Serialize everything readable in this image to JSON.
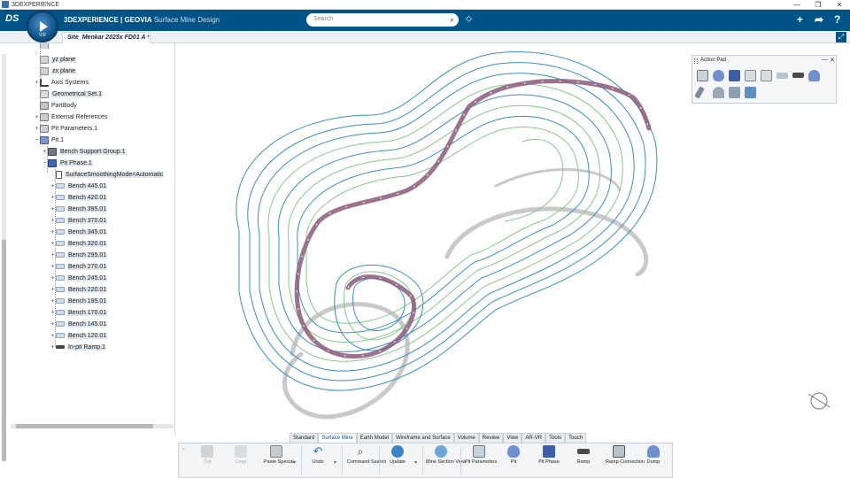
{
  "window": {
    "title": "3DEXPERIENCE",
    "controls": [
      "—",
      "❐",
      "✕"
    ]
  },
  "topbar": {
    "brand_bold": "3DEXPERIENCE | GEOVIA",
    "brand_app": "Surface Mine Design",
    "compass_label": "V.R",
    "search_placeholder": "Search"
  },
  "tabs": {
    "document": "Site_Menkar 2025x FD01 A",
    "add": "+"
  },
  "tree": {
    "items": [
      {
        "label": "yz plane",
        "level": 0
      },
      {
        "label": "zx plane",
        "level": 0
      },
      {
        "label": "Axis Systems",
        "level": 0
      },
      {
        "label": "Geometrical Set.1",
        "level": 0
      },
      {
        "label": "PartBody",
        "level": 0
      },
      {
        "label": "External References",
        "level": 0
      },
      {
        "label": "Pit Parameters.1",
        "level": 0
      },
      {
        "label": "Pit.1",
        "level": 0
      },
      {
        "label": "Bench Support Group.1",
        "level": 1
      },
      {
        "label": "Pit Phase.1",
        "level": 1
      },
      {
        "label": "SurfaceSmoothingMode=Automatic",
        "level": 2
      },
      {
        "label": "Bench 445.01",
        "level": 2
      },
      {
        "label": "Bench 420.01",
        "level": 2
      },
      {
        "label": "Bench 395.01",
        "level": 2
      },
      {
        "label": "Bench 370.01",
        "level": 2
      },
      {
        "label": "Bench 345.01",
        "level": 2
      },
      {
        "label": "Bench 320.01",
        "level": 2
      },
      {
        "label": "Bench 295.01",
        "level": 2
      },
      {
        "label": "Bench 270.01",
        "level": 2
      },
      {
        "label": "Bench 245.01",
        "level": 2
      },
      {
        "label": "Bench 220.01",
        "level": 2
      },
      {
        "label": "Bench 195.01",
        "level": 2
      },
      {
        "label": "Bench 170.01",
        "level": 2
      },
      {
        "label": "Bench 145.01",
        "level": 2
      },
      {
        "label": "Bench 120.01",
        "level": 2
      },
      {
        "label": "In-pit Ramp.1",
        "level": 2
      }
    ]
  },
  "action_pad": {
    "title": "Action Pad"
  },
  "section_tabs": [
    "Standard",
    "Surface Mine",
    "Earth Model",
    "Wireframe and Surface",
    "Volume",
    "Review",
    "View",
    "AR-VR",
    "Tools",
    "Touch"
  ],
  "action_bar": {
    "cut": "Cut",
    "copy": "Copy",
    "paste_special": "Paste Special",
    "undo": "Undo",
    "command_search": "Command Search",
    "update": "Update",
    "mine_section_view": "Mine Section View",
    "pit_parameters": "Pit Parameters",
    "pit": "Pit",
    "pit_phase": "Pit Phase",
    "ramp": "Ramp",
    "ramp_connection": "Ramp Connection",
    "dump": "Dump"
  },
  "colors": {
    "brand_blue": "#005386",
    "contour_blue": "#3a8fc4",
    "contour_green": "#86c98a",
    "ramp": "#8a5a7a"
  }
}
